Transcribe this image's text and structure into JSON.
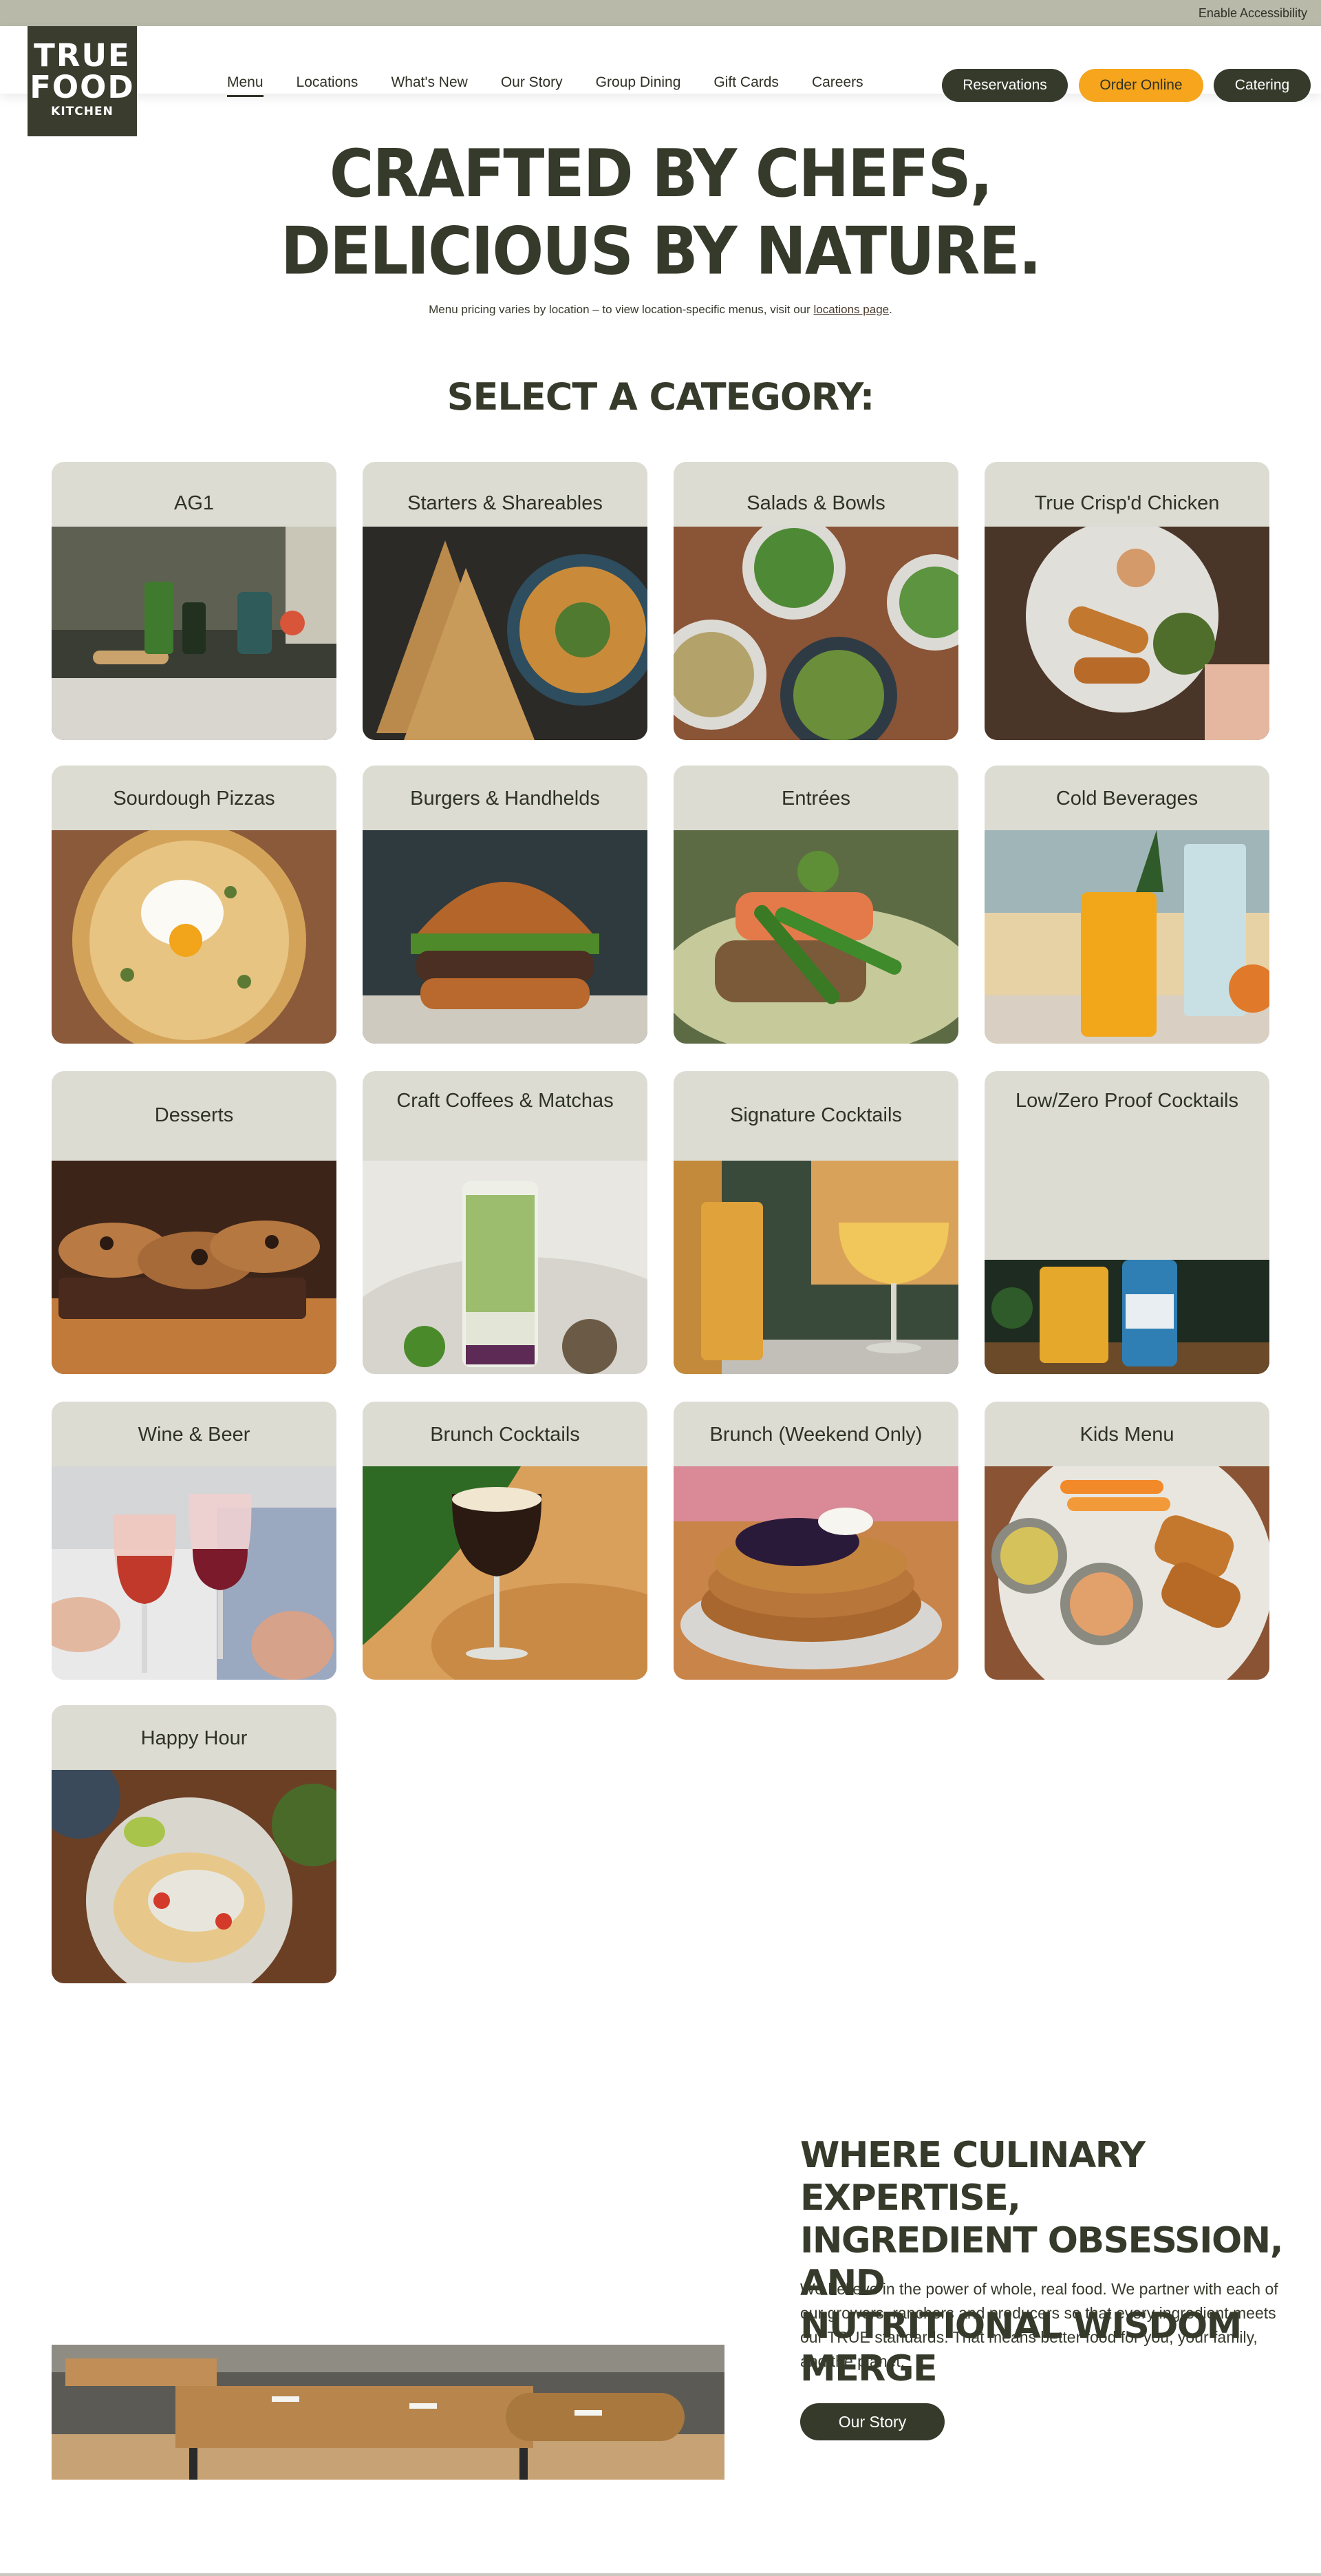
{
  "topbar": {
    "accessibility": "Enable Accessibility"
  },
  "logo": {
    "line1": "TRUE",
    "line2": "FOOD",
    "line3": "KITCHEN"
  },
  "nav": [
    {
      "label": "Menu",
      "active": true
    },
    {
      "label": "Locations"
    },
    {
      "label": "What's New"
    },
    {
      "label": "Our Story"
    },
    {
      "label": "Group Dining"
    },
    {
      "label": "Gift Cards"
    },
    {
      "label": "Careers"
    }
  ],
  "actions": {
    "reservations": "Reservations",
    "order_online": "Order Online",
    "catering": "Catering"
  },
  "hero": {
    "line1": "CRAFTED BY CHEFS,",
    "line2": "DELICIOUS BY NATURE.",
    "note_prefix": "Menu pricing varies by location – to view location-specific menus, visit our ",
    "note_link": "locations page",
    "note_suffix": "."
  },
  "select_title": "SELECT A CATEGORY:",
  "categories": [
    {
      "label": "AG1",
      "icon": "ag1-drinks-image"
    },
    {
      "label": "Starters & Shareables",
      "icon": "flatbread-hummus-image"
    },
    {
      "label": "Salads & Bowls",
      "icon": "salad-bowls-image"
    },
    {
      "label": "True Crisp'd Chicken",
      "icon": "crispy-chicken-image"
    },
    {
      "label": "Sourdough Pizzas",
      "icon": "pizza-image"
    },
    {
      "label": "Burgers & Handhelds",
      "icon": "burger-image"
    },
    {
      "label": "Entrées",
      "icon": "salmon-entree-image"
    },
    {
      "label": "Cold Beverages",
      "icon": "cold-beverage-image"
    },
    {
      "label": "Desserts",
      "icon": "cookies-image"
    },
    {
      "label": "Craft Coffees & Matchas",
      "icon": "matcha-latte-image"
    },
    {
      "label": "Signature Cocktails",
      "icon": "cocktail-image"
    },
    {
      "label": "Low/Zero Proof Cocktails",
      "icon": "mocktail-image"
    },
    {
      "label": "Wine & Beer",
      "icon": "wine-glasses-image"
    },
    {
      "label": "Brunch Cocktails",
      "icon": "espresso-martini-image"
    },
    {
      "label": "Brunch (Weekend Only)",
      "icon": "pancakes-image"
    },
    {
      "label": "Kids Menu",
      "icon": "kids-plate-image"
    },
    {
      "label": "Happy Hour",
      "icon": "tacos-image"
    }
  ],
  "story": {
    "heading_line1": "WHERE CULINARY EXPERTISE,",
    "heading_line2": "INGREDIENT OBSESSION, AND",
    "heading_line3": "NUTRITIONAL WISDOM MERGE",
    "body": "We believe in the power of whole, real food. We partner with each of our growers, ranchers and producers so that every ingredient meets our TRUE standards. That means better food for you, your family, and the planet.",
    "button": "Our Story",
    "image_icon": "dining-room-image"
  },
  "colors": {
    "primary": "#363a2b",
    "accent": "#f6a51c",
    "card_bg": "#dcdcd3",
    "topbar": "#b8b9a8"
  }
}
